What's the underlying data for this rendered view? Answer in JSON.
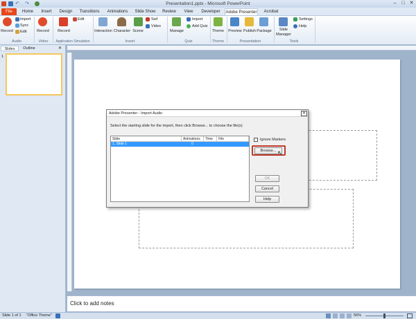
{
  "window": {
    "title": "Presentation1.pptx - Microsoft PowerPoint"
  },
  "tabs": [
    "File",
    "Home",
    "Insert",
    "Design",
    "Transitions",
    "Animations",
    "Slide Show",
    "Review",
    "View",
    "Developer",
    "Adobe Presenter",
    "Acrobat"
  ],
  "ribbon": {
    "groups": [
      "Audio",
      "Video",
      "Application Simulation",
      "Insert",
      "Quiz",
      "Theme",
      "Presentation",
      "Tools"
    ],
    "audio": {
      "record": "Record",
      "import": "Import",
      "sync": "Sync",
      "edit": "Edit"
    },
    "video": {
      "record": "Record"
    },
    "appsim": {
      "record": "Record",
      "edit": "Edit"
    },
    "insert": {
      "interaction": "Interaction",
      "character": "Character",
      "scene": "Scene",
      "swf": "Swf",
      "video": "Video"
    },
    "quiz": {
      "manage": "Manage",
      "import": "Import",
      "add_quiz": "Add Quiz"
    },
    "theme": {
      "theme": "Theme"
    },
    "presentation": {
      "preview": "Preview",
      "publish": "Publish",
      "package": "Package"
    },
    "tools": {
      "slide_manager_1": "Slide",
      "slide_manager_2": "Manager",
      "settings": "Settings",
      "help": "Help"
    }
  },
  "pane": {
    "tab_slides": "Slides",
    "tab_outline": "Outline",
    "slide_number": "1"
  },
  "notes": {
    "placeholder": "Click to add notes"
  },
  "status": {
    "slide": "Slide 1 of 1",
    "theme": "\"Office Theme\"",
    "zoom": "56%"
  },
  "dialog": {
    "title": "Adobe Presenter - Import Audio",
    "instruction": "Select the starting slide for the import, then click Browse... to choose the file(s)",
    "columns": [
      "Slide",
      "Animations",
      "Time",
      "File"
    ],
    "rows": [
      {
        "slide": "1. Slide 1",
        "animations": "0",
        "time": "",
        "file": ""
      }
    ],
    "ignore_markers": "Ignore Markers",
    "browse": "Browse...",
    "ok": "OK",
    "cancel": "Cancel",
    "help": "Help"
  },
  "colors": {
    "file_tab": "#e8461a",
    "selection": "#3399ff",
    "highlight": "#c0392b"
  }
}
